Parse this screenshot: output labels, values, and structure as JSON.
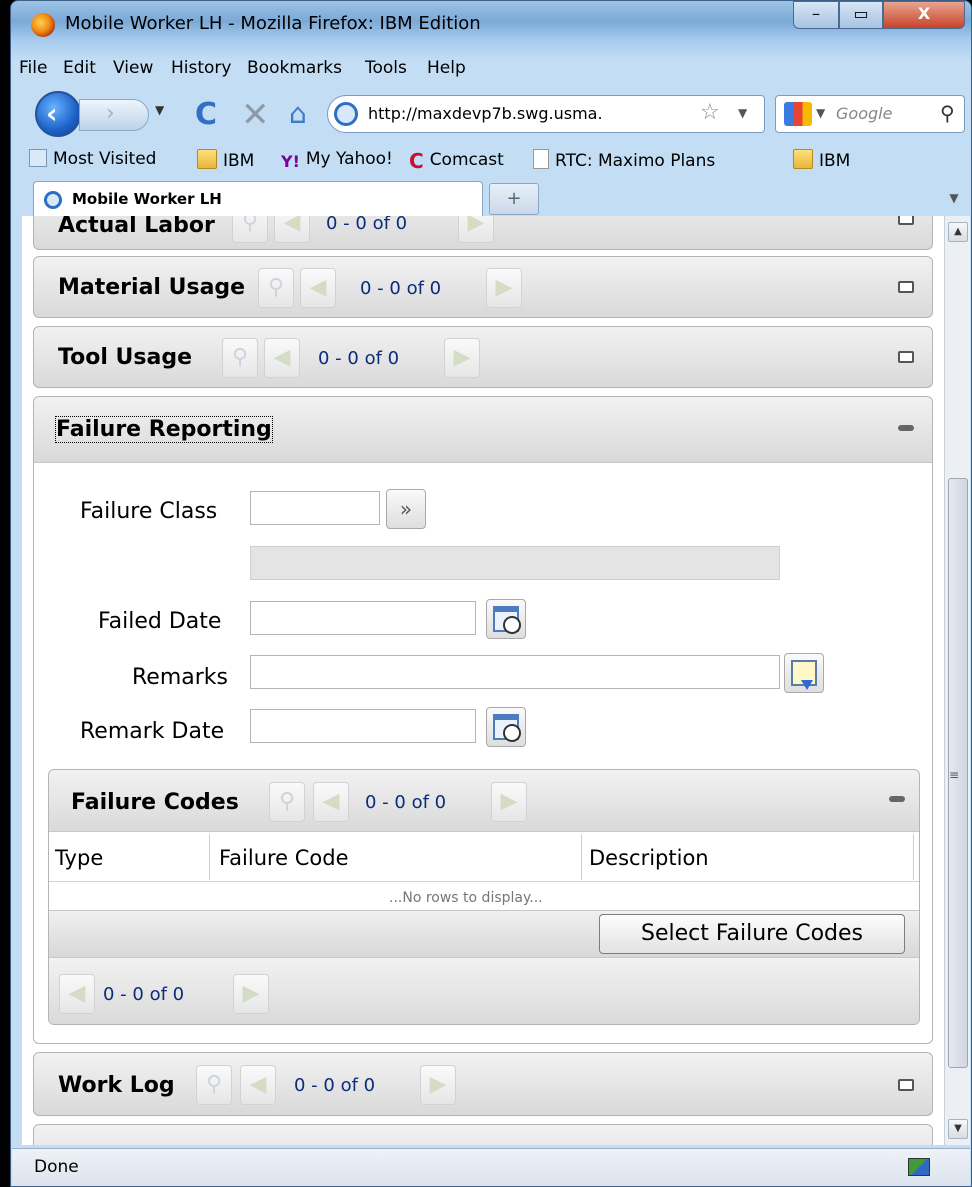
{
  "window": {
    "title": "Mobile Worker LH - Mozilla Firefox: IBM Edition",
    "minimize": "–",
    "maximize": "▭",
    "close": "X"
  },
  "menu": {
    "file": "File",
    "edit": "Edit",
    "view": "View",
    "history": "History",
    "bookmarks": "Bookmarks",
    "tools": "Tools",
    "help": "Help"
  },
  "nav": {
    "url": "http://maxdevp7b.swg.usma.",
    "search_placeholder": "Google"
  },
  "bookmarks_bar": {
    "items": [
      "Most Visited",
      "IBM",
      "My Yahoo!",
      "Comcast",
      "RTC: Maximo Plans",
      "IBM"
    ]
  },
  "tabs": {
    "active": "Mobile Worker LH",
    "new_tab": "+"
  },
  "sections": {
    "actual_labor": {
      "title": "Actual Labor",
      "count": "0 - 0 of 0"
    },
    "material_usage": {
      "title": "Material Usage",
      "count": "0 - 0 of 0"
    },
    "tool_usage": {
      "title": "Tool Usage",
      "count": "0 - 0 of 0"
    },
    "failure_reporting": {
      "title": "Failure Reporting"
    },
    "work_log": {
      "title": "Work Log",
      "count": "0 - 0 of 0"
    }
  },
  "failure_form": {
    "failure_class_label": "Failure Class",
    "failure_class_value": "",
    "failure_class_desc": "",
    "lookup_icon": "»",
    "failed_date_label": "Failed Date",
    "failed_date_value": "",
    "remarks_label": "Remarks",
    "remarks_value": "",
    "remark_date_label": "Remark Date",
    "remark_date_value": ""
  },
  "failure_codes": {
    "title": "Failure Codes",
    "count": "0 - 0 of 0",
    "columns": [
      "Type",
      "Failure Code",
      "Description"
    ],
    "empty_text": "...No rows to display...",
    "select_button": "Select Failure Codes",
    "footer_count": "0 - 0 of 0"
  },
  "status": {
    "text": "Done"
  }
}
